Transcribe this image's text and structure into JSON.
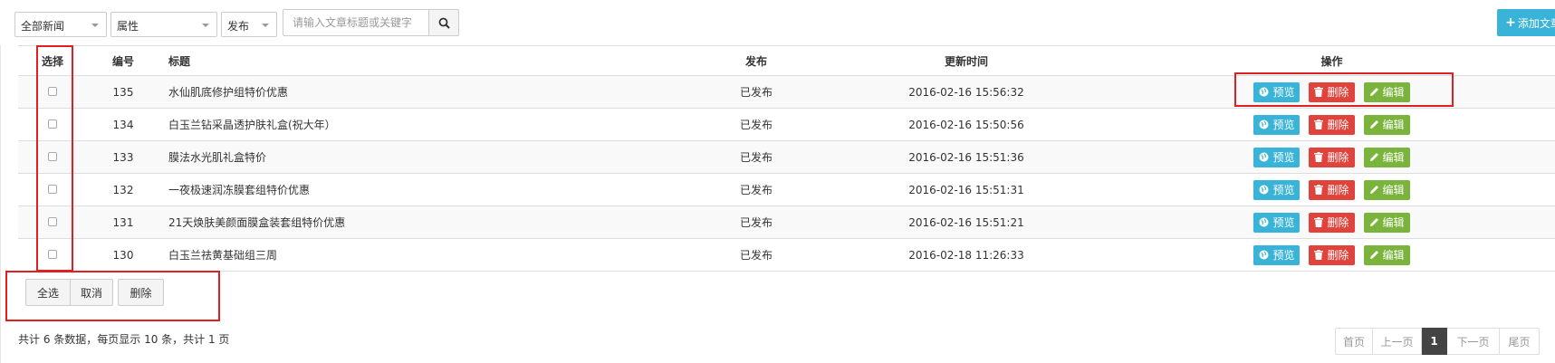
{
  "filters": {
    "category": "全部新闻",
    "attribute": "属性",
    "publish": "发布",
    "search_placeholder": "请输入文章标题或关键字"
  },
  "toolbar": {
    "add_label": "添加文章"
  },
  "table": {
    "headers": {
      "select": "选择",
      "id": "编号",
      "title": "标题",
      "publish": "发布",
      "updated": "更新时间",
      "actions": "操作"
    },
    "rows": [
      {
        "id": "135",
        "title": "水仙肌底修护组特价优惠",
        "publish": "已发布",
        "updated": "2016-02-16 15:56:32"
      },
      {
        "id": "134",
        "title": "白玉兰钻采晶透护肤礼盒(祝大年）",
        "publish": "已发布",
        "updated": "2016-02-16 15:50:56"
      },
      {
        "id": "133",
        "title": "膜法水光肌礼盒特价",
        "publish": "已发布",
        "updated": "2016-02-16 15:51:36"
      },
      {
        "id": "132",
        "title": "一夜极速润冻膜套组特价优惠",
        "publish": "已发布",
        "updated": "2016-02-16 15:51:31"
      },
      {
        "id": "131",
        "title": "21天焕肤美颜面膜盒装套组特价优惠",
        "publish": "已发布",
        "updated": "2016-02-16 15:51:21"
      },
      {
        "id": "130",
        "title": "白玉兰祛黄基础组三周",
        "publish": "已发布",
        "updated": "2016-02-18 11:26:33"
      }
    ],
    "actions": {
      "preview": "预览",
      "delete": "删除",
      "edit": "编辑"
    }
  },
  "bulk": {
    "select_all": "全选",
    "cancel": "取消",
    "delete": "删除"
  },
  "summary": "共计 6 条数据，每页显示 10 条，共计 1 页",
  "pagination": {
    "first": "首页",
    "prev": "上一页",
    "current": "1",
    "next": "下一页",
    "last": "尾页"
  },
  "colors": {
    "preview": "#39b3d7",
    "delete": "#e0433b",
    "edit": "#7ab43c",
    "highlight": "#e02020"
  }
}
